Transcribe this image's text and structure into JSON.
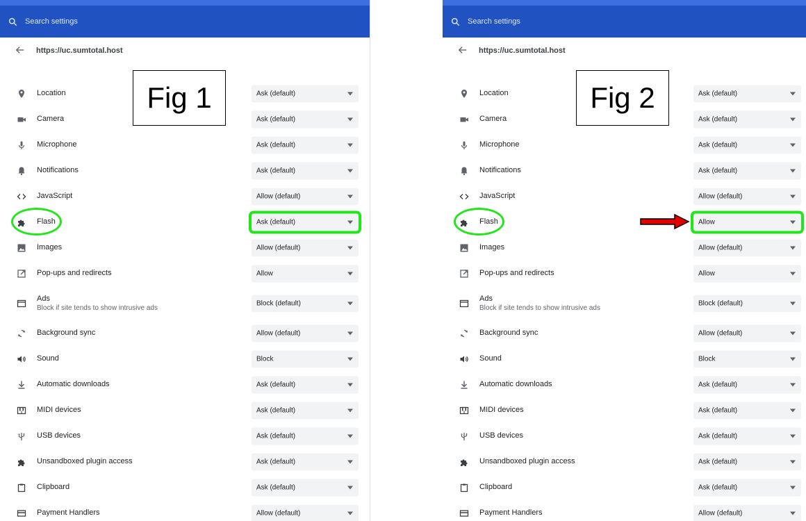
{
  "search": {
    "placeholder": "Search settings"
  },
  "site": {
    "url": "https://uc.sumtotal.host"
  },
  "figures": {
    "fig1": "Fig 1",
    "fig2": "Fig 2"
  },
  "colors": {
    "header": "#2152c2",
    "highlight": "#22e61a",
    "arrow": "#e00000"
  },
  "permissions": [
    {
      "label": "Location",
      "icon": "location-pin-icon"
    },
    {
      "label": "Camera",
      "icon": "camera-icon"
    },
    {
      "label": "Microphone",
      "icon": "microphone-icon"
    },
    {
      "label": "Notifications",
      "icon": "bell-icon"
    },
    {
      "label": "JavaScript",
      "icon": "code-brackets-icon"
    },
    {
      "label": "Flash",
      "icon": "puzzle-icon"
    },
    {
      "label": "Images",
      "icon": "image-icon"
    },
    {
      "label": "Pop-ups and redirects",
      "icon": "open-in-new-icon"
    },
    {
      "label": "Ads",
      "sublabel": "Block if site tends to show intrusive ads",
      "icon": "ad-window-icon"
    },
    {
      "label": "Background sync",
      "icon": "sync-icon"
    },
    {
      "label": "Sound",
      "icon": "speaker-icon"
    },
    {
      "label": "Automatic downloads",
      "icon": "download-icon"
    },
    {
      "label": "MIDI devices",
      "icon": "piano-icon"
    },
    {
      "label": "USB devices",
      "icon": "usb-icon"
    },
    {
      "label": "Unsandboxed plugin access",
      "icon": "puzzle-icon"
    },
    {
      "label": "Clipboard",
      "icon": "clipboard-icon"
    },
    {
      "label": "Payment Handlers",
      "icon": "credit-card-icon"
    }
  ],
  "fig1": {
    "values": [
      "Ask (default)",
      "Ask (default)",
      "Ask (default)",
      "Ask (default)",
      "Allow (default)",
      "Ask (default)",
      "Allow (default)",
      "Allow",
      "Block (default)",
      "Allow (default)",
      "Block",
      "Ask (default)",
      "Ask (default)",
      "Ask (default)",
      "Ask (default)",
      "Ask (default)",
      "Allow (default)"
    ]
  },
  "fig2": {
    "values": [
      "Ask (default)",
      "Ask (default)",
      "Ask (default)",
      "Ask (default)",
      "Allow (default)",
      "Allow",
      "Allow (default)",
      "Allow",
      "Block (default)",
      "Allow (default)",
      "Block",
      "Ask (default)",
      "Ask (default)",
      "Ask (default)",
      "Ask (default)",
      "Ask (default)",
      "Allow (default)"
    ]
  }
}
